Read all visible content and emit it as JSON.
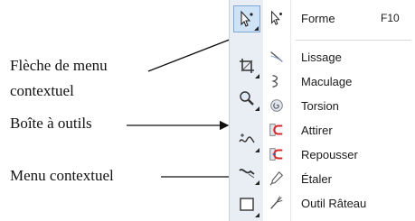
{
  "callouts": [
    {
      "text": "Flèche de menu"
    },
    {
      "text": "contextuel"
    },
    {
      "text": "Boîte à outils"
    },
    {
      "text": "Menu contextuel"
    }
  ],
  "toolbox": {
    "tools": [
      {
        "icon": "shape-tool-icon",
        "active": true
      },
      {
        "icon": "crop-tool-icon"
      },
      {
        "icon": "zoom-tool-icon"
      },
      {
        "icon": "freehand-tool-icon"
      },
      {
        "icon": "artistic-media-icon"
      },
      {
        "icon": "rectangle-tool-icon"
      }
    ]
  },
  "flyout": {
    "items": [
      {
        "label": "Forme",
        "shortcut": "F10",
        "icon": "shape-tool-icon"
      },
      {
        "label": "Lissage",
        "icon": "smooth-tool-icon"
      },
      {
        "label": "Maculage",
        "icon": "smear-tool-icon"
      },
      {
        "label": "Torsion",
        "icon": "twirl-tool-icon"
      },
      {
        "label": "Attirer",
        "icon": "attract-tool-icon"
      },
      {
        "label": "Repousser",
        "icon": "repel-tool-icon"
      },
      {
        "label": "Étaler",
        "icon": "smudge-tool-icon"
      },
      {
        "label": "Outil Râteau",
        "icon": "roughen-tool-icon"
      }
    ]
  },
  "colors": {
    "toolbox_bg": "#e9edf4",
    "active_tool_bg": "#cfe3f7",
    "magnet_red": "#d62828"
  }
}
